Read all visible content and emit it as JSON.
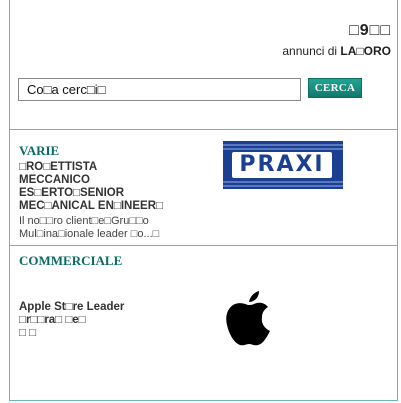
{
  "header": {
    "count": "□9□□",
    "annunci_prefix": "annunci di ",
    "annunci_brand": "LA□ORO"
  },
  "search": {
    "value": "Co□a cerc□i□",
    "button_label": "CERCA"
  },
  "listings": [
    {
      "category": "VARIE",
      "title_lines": [
        "□RO□ETTISTA",
        "MECCANICO",
        "ES□ERTO□SENIOR",
        "MEC□ANICAL EN□INEER□"
      ],
      "desc_lines": [
        "Il no□□ro client□e□Gru□□o",
        "Mul□ina□ionale leader □o...□"
      ],
      "logo": "PRAXI",
      "logo_icon": "praxi-logo"
    },
    {
      "category": "COMMERCIALE",
      "title_lines": [
        "Apple St□re Leader",
        "□r□□ra□ □e□",
        "□  □"
      ],
      "desc_lines": [],
      "logo_icon": "apple-logo"
    }
  ],
  "colors": {
    "accent": "#0b6b64",
    "button": "#13857a",
    "divider": "#6fb3c2",
    "praxi_blue": "#1b3f91"
  }
}
